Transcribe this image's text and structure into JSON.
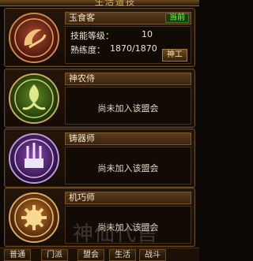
{
  "header": {
    "title": "生活造技"
  },
  "guilds": [
    {
      "name": "玉食客",
      "badge": "当前",
      "skill_label": "技能等级：",
      "skill_value": "10",
      "prof_label": "熟练度：",
      "prof_value": "1870/1870",
      "button": "神工"
    },
    {
      "name": "神农侍",
      "status": "尚未加入该盟会"
    },
    {
      "name": "铸器师",
      "status": "尚未加入该盟会"
    },
    {
      "name": "机巧师",
      "status": "尚未加入该盟会"
    }
  ],
  "tabs": [
    "普通",
    "门派",
    "盟会",
    "生活",
    "战斗"
  ],
  "watermark": "神仙代售"
}
